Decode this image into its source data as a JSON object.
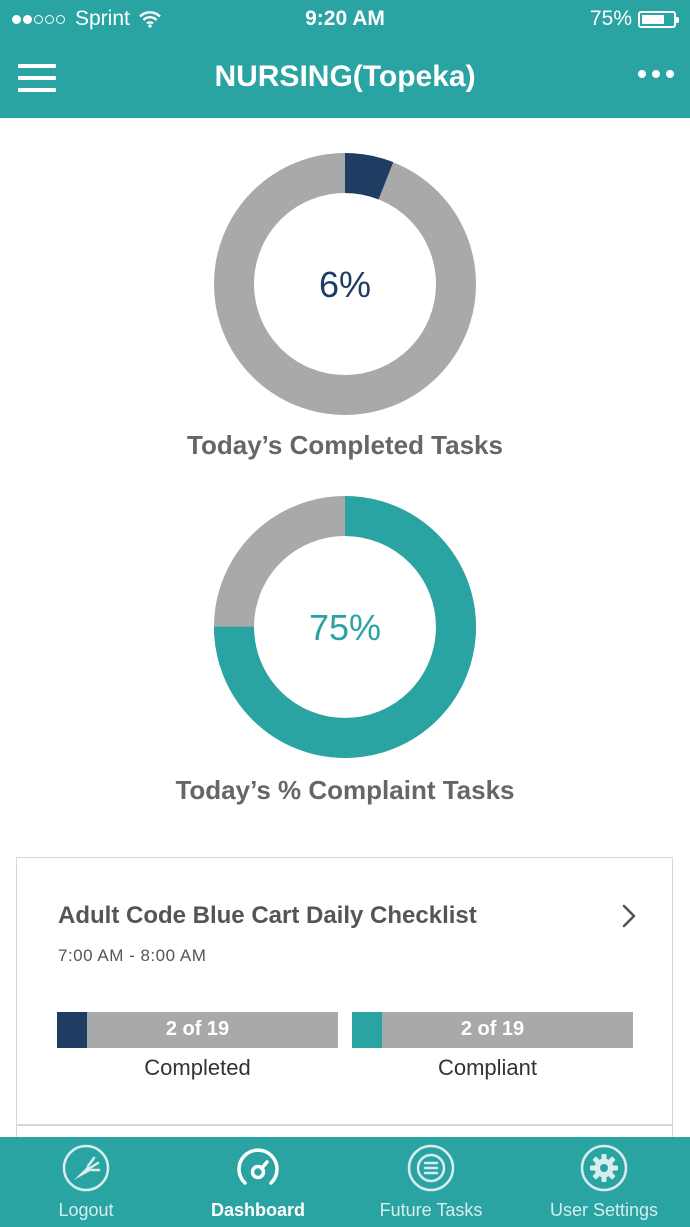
{
  "status_bar": {
    "carrier": "Sprint",
    "time": "9:20 AM",
    "battery": "75%",
    "battery_level": 0.75,
    "signal_bars_filled": 2,
    "signal_bars_total": 5
  },
  "header": {
    "title": "NURSING(Topeka)",
    "menu_icon": "hamburger-icon",
    "more_icon": "more-dots-icon"
  },
  "charts": {
    "completed": {
      "value_label": "6%",
      "fraction": 0.06,
      "label": "Today’s Completed Tasks"
    },
    "compliant": {
      "value_label": "75%",
      "fraction": 0.75,
      "label": "Today’s % Complaint Tasks"
    }
  },
  "task_card": {
    "title": "Adult Code Blue Cart Daily Checklist",
    "time_range": "7:00 AM - 8:00 AM",
    "completed": {
      "text": "2 of 19",
      "caption": "Completed",
      "done": 2,
      "total": 19
    },
    "compliant": {
      "text": "2 of 19",
      "caption": "Compliant",
      "done": 2,
      "total": 19
    }
  },
  "tabs": [
    {
      "label": "Logout",
      "icon": "logout-icon",
      "active": false
    },
    {
      "label": "Dashboard",
      "icon": "gauge-icon",
      "active": true
    },
    {
      "label": "Future Tasks",
      "icon": "list-icon",
      "active": false
    },
    {
      "label": "User Settings",
      "icon": "gear-icon",
      "active": false
    }
  ],
  "colors": {
    "brand_teal": "#2aa3a3",
    "navy": "#1f3d63",
    "track_gray": "#a9a9a9",
    "label_gray": "#666666"
  }
}
